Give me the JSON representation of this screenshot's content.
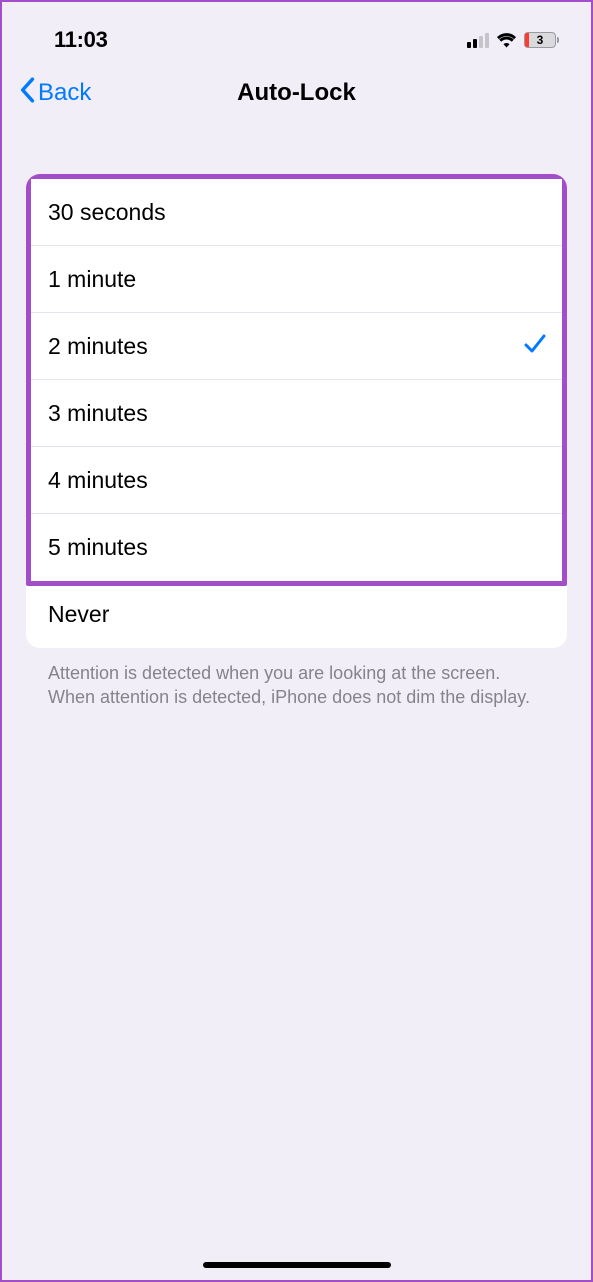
{
  "statusBar": {
    "time": "11:03",
    "batteryPercent": "3"
  },
  "nav": {
    "backLabel": "Back",
    "title": "Auto-Lock"
  },
  "options": [
    {
      "label": "30 seconds",
      "selected": false
    },
    {
      "label": "1 minute",
      "selected": false
    },
    {
      "label": "2 minutes",
      "selected": true
    },
    {
      "label": "3 minutes",
      "selected": false
    },
    {
      "label": "4 minutes",
      "selected": false
    },
    {
      "label": "5 minutes",
      "selected": false
    },
    {
      "label": "Never",
      "selected": false
    }
  ],
  "footerText": "Attention is detected when you are looking at the screen. When attention is detected, iPhone does not dim the display."
}
